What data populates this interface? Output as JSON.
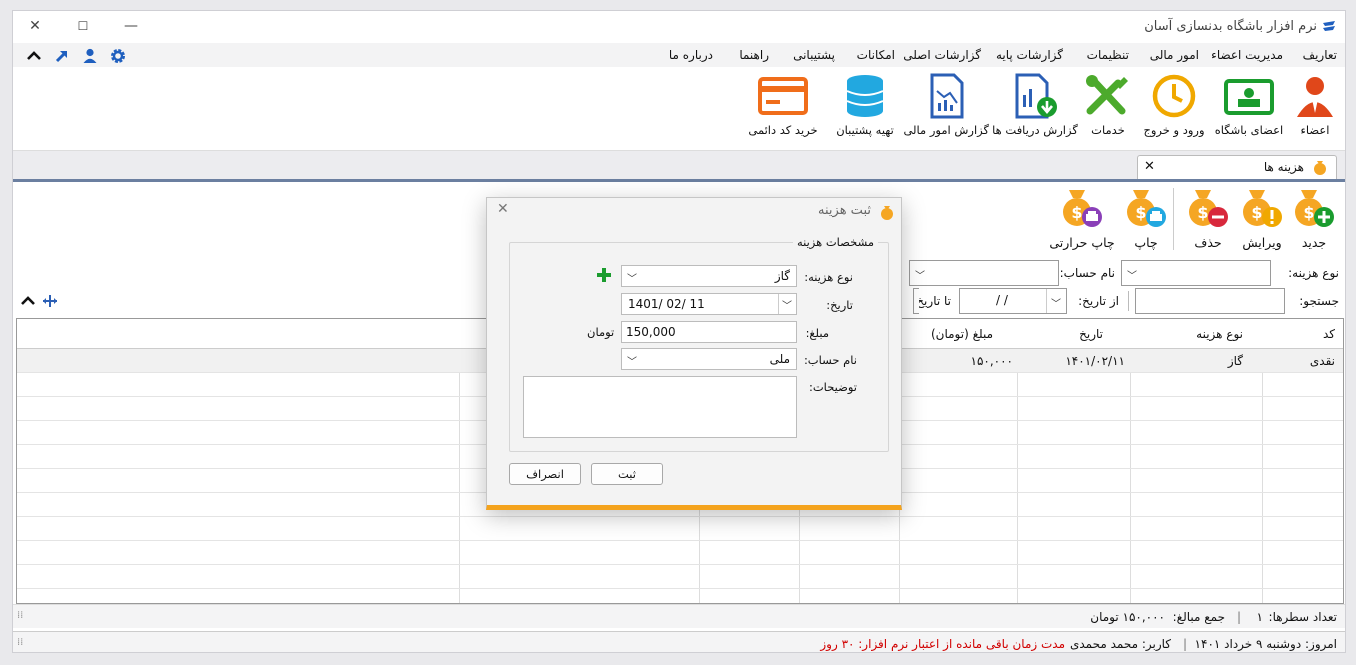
{
  "app": {
    "title": "نرم افزار باشگاه بدنسازی آسان"
  },
  "menu": [
    "تعاریف",
    "مدیریت اعضاء",
    "امور مالی",
    "تنظیمات",
    "گزارشات پایه",
    "گزارشات اصلی",
    "امکانات",
    "پشتیبانی",
    "راهنما",
    "درباره ما"
  ],
  "ribbon": [
    "اعضاء",
    "اعضای باشگاه",
    "ورود و خروج",
    "خدمات",
    "گزارش دریافت ها",
    "گزارش امور مالی",
    "تهیه پشتیبان",
    "خرید کد دائمی"
  ],
  "tab": {
    "label": "هزینه ها"
  },
  "toolbar": {
    "new": "جدید",
    "edit": "ویرایش",
    "delete": "حذف",
    "print": "چاپ",
    "thermal_print": "چاپ حرارتی"
  },
  "filters": {
    "expense_type": "نوع هزینه:",
    "account_name": "نام حساب:",
    "search": "جستجو:",
    "from_date": "از تاریخ:",
    "to_date": "تا تاریخ:",
    "date_placeholder": "/      /"
  },
  "grid": {
    "headers": [
      "کد",
      "نوع هزینه",
      "تاریخ",
      "مبلغ (تومان)"
    ],
    "row1": {
      "code": "نقدی",
      "type": "گاز",
      "date": "۱۴۰۱/۰۲/۱۱",
      "amount": "۱۵۰,۰۰۰"
    }
  },
  "summary": {
    "row_count_label": "تعداد سطرها:",
    "row_count": "۱",
    "total_label": "جمع مبالغ:",
    "total": "۱۵۰,۰۰۰ تومان"
  },
  "status": {
    "date": "امروز: دوشنبه ۹ خرداد ۱۴۰۱",
    "user": "کاربر: محمد محمدی",
    "license": "مدت زمان باقی مانده از اعتبار نرم افزار: ۳۰ روز"
  },
  "dialog": {
    "title": "ثبت هزینه",
    "legend": "مشخصات هزینه",
    "labels": {
      "type": "نوع هزینه:",
      "date": "تاریخ:",
      "amount": "مبلغ:",
      "account": "نام حساب:",
      "notes": "توضیحات:"
    },
    "values": {
      "type": "گاز",
      "date": "1401/ 02/ 11",
      "amount": "150,000",
      "unit": "تومان",
      "account": "ملی"
    },
    "buttons": {
      "save": "ثبت",
      "cancel": "انصراف"
    }
  },
  "colors": {
    "accent": "#f4a31d",
    "brand_blue": "#1f5fbf",
    "money_orange": "#f5a623",
    "green": "#1a9c2e",
    "red_text": "#d10000"
  }
}
